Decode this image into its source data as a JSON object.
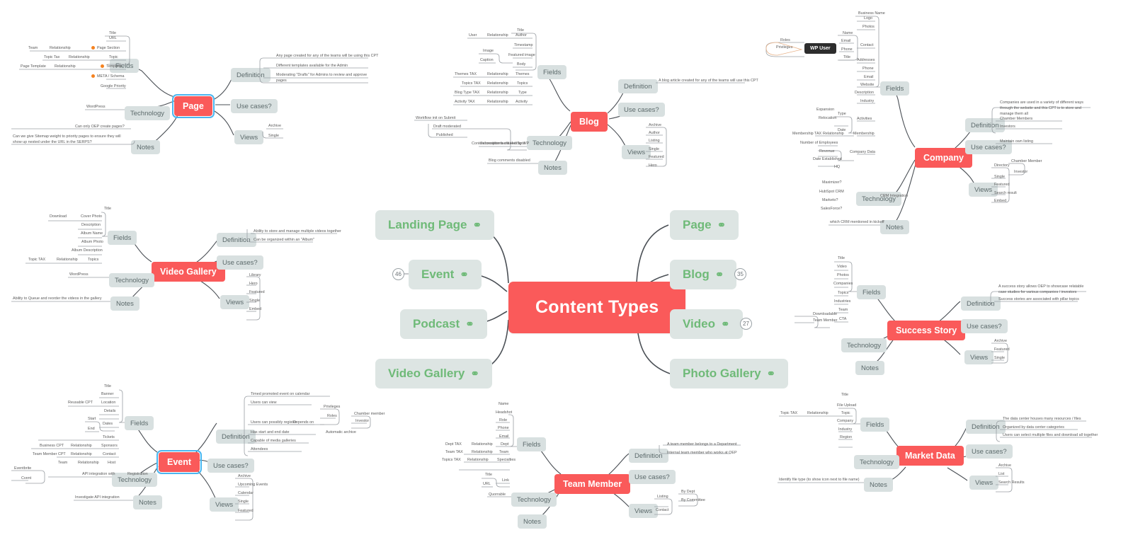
{
  "root": {
    "label": "Content Types",
    "color": "#fa5a5a"
  },
  "main_topics": {
    "left": [
      {
        "label": "Landing Page",
        "icon": "link-icon",
        "badge": null
      },
      {
        "label": "Event",
        "icon": "link-icon",
        "badge": "46"
      },
      {
        "label": "Podcast",
        "icon": "link-icon",
        "badge": null
      },
      {
        "label": "Video Gallery",
        "icon": "link-icon",
        "badge": null
      }
    ],
    "right": [
      {
        "label": "Page",
        "icon": "link-icon",
        "badge": null
      },
      {
        "label": "Blog",
        "icon": "link-icon",
        "badge": "35"
      },
      {
        "label": "Video",
        "icon": "link-icon",
        "badge": "27"
      },
      {
        "label": "Photo Gallery",
        "icon": "link-icon",
        "badge": null
      }
    ]
  },
  "branch_labels": {
    "fields": "Fields",
    "definition": "Definition",
    "use_cases": "Use cases?",
    "technology": "Technology",
    "views": "Views",
    "notes": "Notes",
    "relationship": "Relationship"
  },
  "clusters": {
    "page": {
      "title": "Page",
      "selected": true,
      "fields": [
        {
          "name": "Title"
        },
        {
          "name": "URL"
        },
        {
          "name": "Page Section",
          "flag": true,
          "rel": "Relationship",
          "src": "Team"
        },
        {
          "name": "Topic",
          "rel": "Relationship",
          "src": "Topic Tax"
        },
        {
          "name": "Template",
          "flag": true,
          "rel": "Relationship",
          "src": "Page Template"
        },
        {
          "name": "META / Schema",
          "flag": true
        },
        {
          "name": "Google Priority"
        }
      ],
      "definition": [
        "Any page created for any of the teams will be using this CPT",
        "Different templates available for the Admin",
        "Moderating \"Drafts\" for Admins to review and approve pages"
      ],
      "technology": [
        "WordPress"
      ],
      "views": [
        "Archive",
        "Single"
      ],
      "notes": [
        "Can only OEP create pages?",
        "Can we give Sitemap weight to priority pages to ensure they will show up nested under the URL in the SERPS?"
      ]
    },
    "blog": {
      "title": "Blog",
      "fields": [
        {
          "name": "Title"
        },
        {
          "name": "Author",
          "rel": "Relationship",
          "src": "User"
        },
        {
          "name": "Timestamp"
        },
        {
          "name": "Featured image",
          "children": [
            "Image",
            "Caption"
          ]
        },
        {
          "name": "Body"
        },
        {
          "name": "Themes",
          "rel": "Relationship",
          "src": "Themes TAX"
        },
        {
          "name": "Topics",
          "rel": "Relationship",
          "src": "Topics TAX"
        },
        {
          "name": "Type",
          "rel": "Relationship",
          "src": "Blog Type TAX"
        },
        {
          "name": "Activity",
          "rel": "Relationship",
          "src": "Activity TAX"
        }
      ],
      "definition": [
        "A blog article created for any of the teams will use this CPT"
      ],
      "technology": [
        {
          "name": "Content creation facilitated by WP",
          "children": [
            "Workflow init on Submit",
            "Draft moderated",
            "Published"
          ]
        },
        {
          "name": "Subscriptions via HubSpot"
        }
      ],
      "views": [
        "Archive",
        "Author",
        "Listing",
        "Single",
        "Featured",
        "Hero"
      ],
      "notes": [
        "Blog comments disabled"
      ]
    },
    "company": {
      "title": "Company",
      "fields": [
        {
          "name": "Business Name"
        },
        {
          "name": "Logo"
        },
        {
          "name": "Photos"
        },
        {
          "name": "Contact",
          "children": [
            "Name",
            "Email",
            "Phone",
            "Title"
          ],
          "user_node": "WP User",
          "user_children": [
            "Roles",
            "Privileges"
          ]
        },
        {
          "name": "Addresses"
        },
        {
          "name": "Phone"
        },
        {
          "name": "Email"
        },
        {
          "name": "Website"
        },
        {
          "name": "Description"
        },
        {
          "name": "Industry"
        },
        {
          "name": "Activities",
          "children": [
            "Type",
            "Date"
          ],
          "type_children": [
            "Expansion",
            "Relocation"
          ]
        },
        {
          "name": "Membership",
          "rel": "Relationship",
          "src": "Membership TAX"
        },
        {
          "name": "Company Data",
          "children": [
            "Number of Employees",
            "Revenue",
            "Date Established",
            "HQ"
          ]
        }
      ],
      "definition": [
        "Companies are used in a variety of different ways through the website and this CPT is to store and manage them all",
        "Chamber Members",
        "Investors"
      ],
      "use_cases": [
        "Maintain own listing"
      ],
      "technology": [
        {
          "name": "CRM Integration",
          "children": [
            "Maximizer?",
            "HubSpot CRM",
            "Marketo?",
            "SalesForce?"
          ]
        }
      ],
      "views": [
        {
          "name": "Directory",
          "children": [
            "Chamber Member",
            "Investor"
          ]
        },
        {
          "name": "Single"
        },
        {
          "name": "Featured"
        },
        {
          "name": "Search result"
        },
        {
          "name": "Embed"
        }
      ],
      "notes": [
        "which CRM mentioned in kickoff"
      ]
    },
    "video_gallery": {
      "title": "Video Gallery",
      "fields": [
        {
          "name": "Title"
        },
        {
          "name": "Cover Photo",
          "src": "Download"
        },
        {
          "name": "Description"
        },
        {
          "name": "Album Name"
        },
        {
          "name": "Album Photo"
        },
        {
          "name": "Album Description"
        },
        {
          "name": "Topics",
          "rel": "Relationship",
          "src": "Topic TAX"
        }
      ],
      "definition": [
        "Ability to store and manage multiple videos together",
        "Can be organized within an \"Album\""
      ],
      "technology": [
        "WordPress"
      ],
      "views": [
        "Library",
        "Hero",
        "Featured",
        "Single",
        "Embed"
      ],
      "notes": [
        "Ability to Queue and reorder the videos in the gallery"
      ]
    },
    "success_story": {
      "title": "Success Story",
      "fields": [
        {
          "name": "Title"
        },
        {
          "name": "Video"
        },
        {
          "name": "Photos"
        },
        {
          "name": "Companies"
        },
        {
          "name": "Topics"
        },
        {
          "name": "Industries"
        },
        {
          "name": "Team"
        },
        {
          "name": "CTA",
          "children": [
            "Downloadable",
            "Team Member"
          ]
        }
      ],
      "definition": [
        "A success story allows OEP to showcase relatable case studies for various companies / investors",
        "Success stories are associated with pillar topics"
      ],
      "views": [
        "Archive",
        "Featured",
        "Single"
      ]
    },
    "event": {
      "title": "Event",
      "selected": true,
      "fields": [
        {
          "name": "Title"
        },
        {
          "name": "Banner"
        },
        {
          "name": "Location",
          "src": "Reusable CPT"
        },
        {
          "name": "Details"
        },
        {
          "name": "Dates",
          "children": [
            "Start",
            "End"
          ]
        },
        {
          "name": "Tickets"
        },
        {
          "name": "Sponsors",
          "rel": "Relationship",
          "src": "Business CPT"
        },
        {
          "name": "Contact",
          "rel": "Relationship",
          "src": "Team Member CPT"
        },
        {
          "name": "Host",
          "rel": "Relationship",
          "src": "Team"
        }
      ],
      "definition": [
        "Timed promoted event on calendar",
        "Users can view",
        "Users can possibly register",
        "Has start and end date",
        "Capable of media galleries",
        "Attendees"
      ],
      "definition_extra": {
        "depends_on": "Depends on",
        "privileges": "Privileges",
        "roles": "Roles",
        "roles_children": [
          "Chamber member",
          "Investor"
        ],
        "auto_archive": "Automatic archive"
      },
      "technology": [
        {
          "name": "Registration",
          "rel": "API integration with",
          "src": [
            "Eventbrite",
            "Cvent"
          ]
        }
      ],
      "views": [
        "Archive",
        "Upcoming Events",
        "Calendar",
        "Single",
        "Featured"
      ],
      "notes": [
        "Investigate API integration"
      ]
    },
    "team_member": {
      "title": "Team Member",
      "fields": [
        {
          "name": "Name"
        },
        {
          "name": "Headshot"
        },
        {
          "name": "Role"
        },
        {
          "name": "Phone"
        },
        {
          "name": "Email"
        },
        {
          "name": "Dept",
          "rel": "Relationship",
          "src": "Dept TAX"
        },
        {
          "name": "Team",
          "rel": "Relationship",
          "src": "Team TAX"
        },
        {
          "name": "Specialties",
          "rel": "Relationship",
          "src": "Topics TAX"
        },
        {
          "name": "Link",
          "children": [
            "Title",
            "URL"
          ]
        }
      ],
      "definition": [
        "A team member belongs to a Department",
        "Internal team member who works at OEP"
      ],
      "technology": [
        "Quorrable"
      ],
      "views": [
        {
          "name": "Listing",
          "children": [
            "By Dept",
            "By Committee"
          ]
        },
        {
          "name": "Contact"
        }
      ]
    },
    "market_data": {
      "title": "Market Data",
      "fields": [
        {
          "name": "Title"
        },
        {
          "name": "File Upload"
        },
        {
          "name": "Topic",
          "rel": "Relationship",
          "src": "Topic TAX"
        },
        {
          "name": "Company"
        },
        {
          "name": "Industry"
        },
        {
          "name": "Region"
        }
      ],
      "definition": [
        "The data center houses many resources / files",
        "Organized by data center categories",
        "Users can select multiple files and download all together"
      ],
      "views": [
        "Archive",
        "List",
        "Search Results"
      ],
      "notes": [
        "Identify file type (to show icon next to file name)"
      ]
    }
  }
}
